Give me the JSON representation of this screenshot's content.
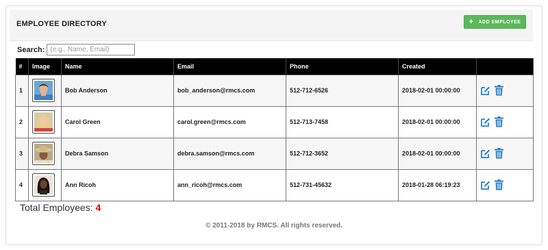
{
  "header": {
    "title": "EMPLOYEE DIRECTORY",
    "add_button_label": "ADD EMPLOYEE",
    "add_button_color": "#5cb85c"
  },
  "search": {
    "label": "Search:",
    "placeholder": "(e.g., Name, Email)",
    "value": ""
  },
  "table": {
    "columns": [
      "#",
      "Image",
      "Name",
      "Email",
      "Phone",
      "Created",
      ""
    ],
    "rows": [
      {
        "num": "1",
        "name": "Bob Anderson",
        "email": "bob_anderson@rmcs.com",
        "phone": "512-712-6526",
        "created": "2018-02-01 00:00:00",
        "avatar": "man-blue-shirt"
      },
      {
        "num": "2",
        "name": "Carol Green",
        "email": "carol.green@rmcs.com",
        "phone": "512-713-7458",
        "created": "2018-02-01 00:00:00",
        "avatar": "woman-blonde"
      },
      {
        "num": "3",
        "name": "Debra Samson",
        "email": "debra.samson@rmcs.com",
        "phone": "512-712-3652",
        "created": "2018-02-01 00:00:00",
        "avatar": "woman-hat"
      },
      {
        "num": "4",
        "name": "Ann Ricoh",
        "email": "ann_ricoh@rmcs.com",
        "phone": "512-731-45632",
        "created": "2018-01-28 06:19:23",
        "avatar": "woman-dark-hair"
      }
    ],
    "action_icons": [
      "edit-icon",
      "trash-icon"
    ],
    "action_color": "#2a7fc4"
  },
  "summary": {
    "label": "Total Employees:",
    "count": "4"
  },
  "footer": {
    "text": "© 2011-2018 by RMCS. All rights reserved."
  }
}
